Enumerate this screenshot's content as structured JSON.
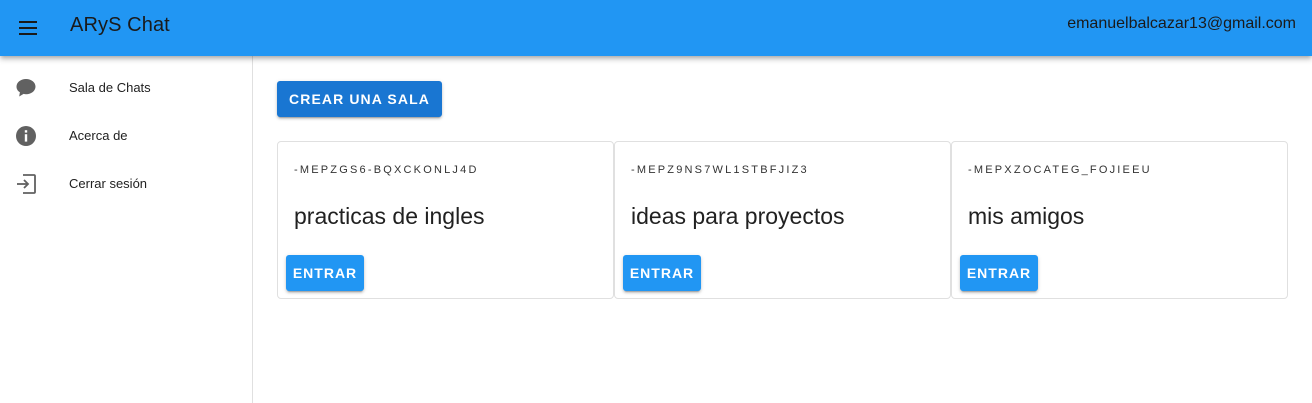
{
  "app_bar": {
    "menu_icon": "hamburger-menu-icon",
    "title": "ARyS Chat",
    "user_email": "emanuelbalcazar13@gmail.com",
    "color": "#2196f3"
  },
  "drawer": {
    "items": [
      {
        "label": "Sala de Chats",
        "icon": "chat-bubble-icon"
      },
      {
        "label": "Acerca de",
        "icon": "info-icon"
      },
      {
        "label": "Cerrar sesión",
        "icon": "logout-icon"
      }
    ]
  },
  "main": {
    "create_button_label": "CREAR UNA SALA",
    "enter_color": "#2196f3",
    "create_color": "#1976d2",
    "rooms": [
      {
        "id": "-MEPZGS6-BQXCKONLJ4D",
        "name": "practicas de ingles",
        "enter_label": "ENTRAR"
      },
      {
        "id": "-MEPZ9NS7WL1STBFJIZ3",
        "name": "ideas para proyectos",
        "enter_label": "ENTRAR"
      },
      {
        "id": "-MEPXZOCATEG_FOJIEEU",
        "name": "mis amigos",
        "enter_label": "ENTRAR"
      }
    ]
  }
}
